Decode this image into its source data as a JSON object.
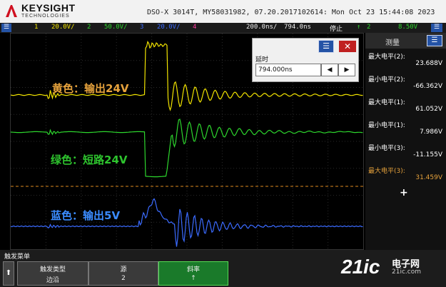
{
  "header": {
    "brand": "KEYSIGHT",
    "brand_sub": "TECHNOLOGIES",
    "device_info": "DSO-X 3014T, MY58031982, 07.20.2017102614: Mon Oct 23 15:44:08 2023"
  },
  "channel_bar": {
    "ch1": "1",
    "ch1_scale": "20.0V/",
    "ch2": "2",
    "ch2_scale": "50.0V/",
    "ch3": "3",
    "ch3_scale": "20.0V/",
    "ch4": "4",
    "timebase": "200.0ns/",
    "delay": "794.0ns",
    "run_state": "停止",
    "trig_ch": "2",
    "trig_level": "8.50V"
  },
  "overlays": {
    "yellow": "黄色：输出24V",
    "green": "绿色：短路24V",
    "blue": "蓝色：输出5V"
  },
  "delay_panel": {
    "title": "延时",
    "value": "794.000ns",
    "menu_icon": "menu-icon",
    "close_icon": "close-icon",
    "left_arrow": "◀",
    "right_arrow": "▶",
    "menu_glyph": "☰",
    "close_glyph": "✕"
  },
  "measurements": {
    "title": "测量",
    "items": [
      {
        "label": "最大电平(2):",
        "value": "23.688V",
        "color": "#ffffff"
      },
      {
        "label": "最小电平(2):",
        "value": "-66.362V",
        "color": "#ffffff"
      },
      {
        "label": "最大电平(1):",
        "value": "61.052V",
        "color": "#ffffff"
      },
      {
        "label": "最小电平(1):",
        "value": "7.986V",
        "color": "#ffffff"
      },
      {
        "label": "最小电平(3):",
        "value": "-11.155V",
        "color": "#ffffff"
      },
      {
        "label": "最大电平(3):",
        "value": "31.459V",
        "color": "#e6a23c"
      }
    ],
    "add": "+"
  },
  "softkeys": {
    "menu_title": "触发菜单",
    "up": "⬆",
    "type_label": "触发类型",
    "type_value": "边沿",
    "source_label": "源",
    "source_value": "2",
    "slope_label": "斜率",
    "slope_value": "↑"
  },
  "watermark": {
    "main": "21ic",
    "cn": "电子网",
    "url": "21ic.com"
  },
  "colors": {
    "ch1": "#f2e400",
    "ch2": "#2dd62d",
    "ch3": "#3b6bff",
    "ch4": "#ff3aa0",
    "trigger": "#e08a1e"
  }
}
